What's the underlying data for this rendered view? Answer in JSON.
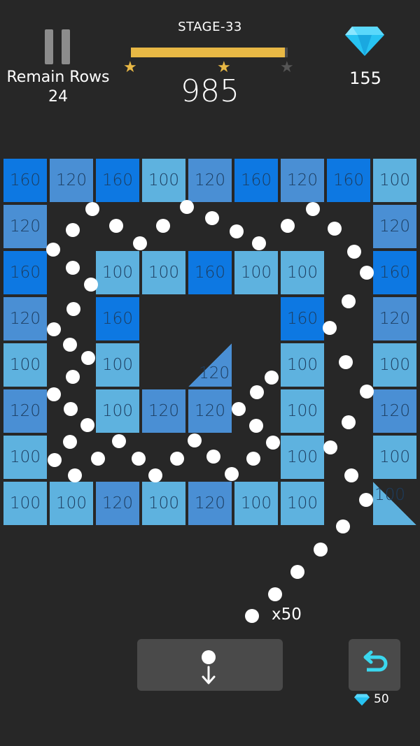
{
  "header": {
    "remain_rows_label": "Remain Rows",
    "remain_rows_value": "24",
    "stage_label": "STAGE-33",
    "progress_fraction": 0.98,
    "stars": [
      {
        "state": "earned",
        "color": "#e8b845"
      },
      {
        "state": "earned",
        "color": "#e8b845"
      },
      {
        "state": "empty",
        "color": "#555555"
      }
    ],
    "score": "985",
    "gem_icon": "diamond-icon",
    "gem_count": "155"
  },
  "board": {
    "colors": {
      "160": "#0d78e2",
      "120": "#4a8fd4",
      "100": "#5eb2df",
      "ball": "#ffffff",
      "background": "#272727"
    },
    "bricks": [
      {
        "row": 0,
        "col": 0,
        "value": "160"
      },
      {
        "row": 0,
        "col": 1,
        "value": "120"
      },
      {
        "row": 0,
        "col": 2,
        "value": "160"
      },
      {
        "row": 0,
        "col": 3,
        "value": "100"
      },
      {
        "row": 0,
        "col": 4,
        "value": "120"
      },
      {
        "row": 0,
        "col": 5,
        "value": "160"
      },
      {
        "row": 0,
        "col": 6,
        "value": "120"
      },
      {
        "row": 0,
        "col": 7,
        "value": "160"
      },
      {
        "row": 0,
        "col": 8,
        "value": "100"
      },
      {
        "row": 1,
        "col": 0,
        "value": "120"
      },
      {
        "row": 1,
        "col": 8,
        "value": "120"
      },
      {
        "row": 2,
        "col": 0,
        "value": "160"
      },
      {
        "row": 2,
        "col": 2,
        "value": "100"
      },
      {
        "row": 2,
        "col": 3,
        "value": "100"
      },
      {
        "row": 2,
        "col": 4,
        "value": "160"
      },
      {
        "row": 2,
        "col": 5,
        "value": "100"
      },
      {
        "row": 2,
        "col": 6,
        "value": "100"
      },
      {
        "row": 2,
        "col": 8,
        "value": "160"
      },
      {
        "row": 3,
        "col": 0,
        "value": "120"
      },
      {
        "row": 3,
        "col": 2,
        "value": "160"
      },
      {
        "row": 3,
        "col": 6,
        "value": "160"
      },
      {
        "row": 3,
        "col": 8,
        "value": "120"
      },
      {
        "row": 4,
        "col": 0,
        "value": "100"
      },
      {
        "row": 4,
        "col": 2,
        "value": "100"
      },
      {
        "row": 4,
        "col": 4,
        "value": "120",
        "shape": "triangle-bottom-right"
      },
      {
        "row": 4,
        "col": 6,
        "value": "100"
      },
      {
        "row": 4,
        "col": 8,
        "value": "100"
      },
      {
        "row": 5,
        "col": 0,
        "value": "120"
      },
      {
        "row": 5,
        "col": 2,
        "value": "100"
      },
      {
        "row": 5,
        "col": 3,
        "value": "120"
      },
      {
        "row": 5,
        "col": 4,
        "value": "120"
      },
      {
        "row": 5,
        "col": 6,
        "value": "100"
      },
      {
        "row": 5,
        "col": 8,
        "value": "120"
      },
      {
        "row": 6,
        "col": 0,
        "value": "100"
      },
      {
        "row": 6,
        "col": 6,
        "value": "100"
      },
      {
        "row": 6,
        "col": 8,
        "value": "100"
      },
      {
        "row": 7,
        "col": 0,
        "value": "100"
      },
      {
        "row": 7,
        "col": 1,
        "value": "100"
      },
      {
        "row": 7,
        "col": 2,
        "value": "120"
      },
      {
        "row": 7,
        "col": 3,
        "value": "100"
      },
      {
        "row": 7,
        "col": 4,
        "value": "120"
      },
      {
        "row": 7,
        "col": 5,
        "value": "100"
      },
      {
        "row": 7,
        "col": 6,
        "value": "100"
      },
      {
        "row": 7,
        "col": 8,
        "value": "100",
        "shape": "triangle-bottom-left"
      }
    ],
    "ball_count": "x50"
  },
  "controls": {
    "drop_icon": "ball-drop-icon",
    "undo_icon": "undo-icon",
    "undo_cost_icon": "diamond-icon",
    "undo_cost": "50"
  }
}
